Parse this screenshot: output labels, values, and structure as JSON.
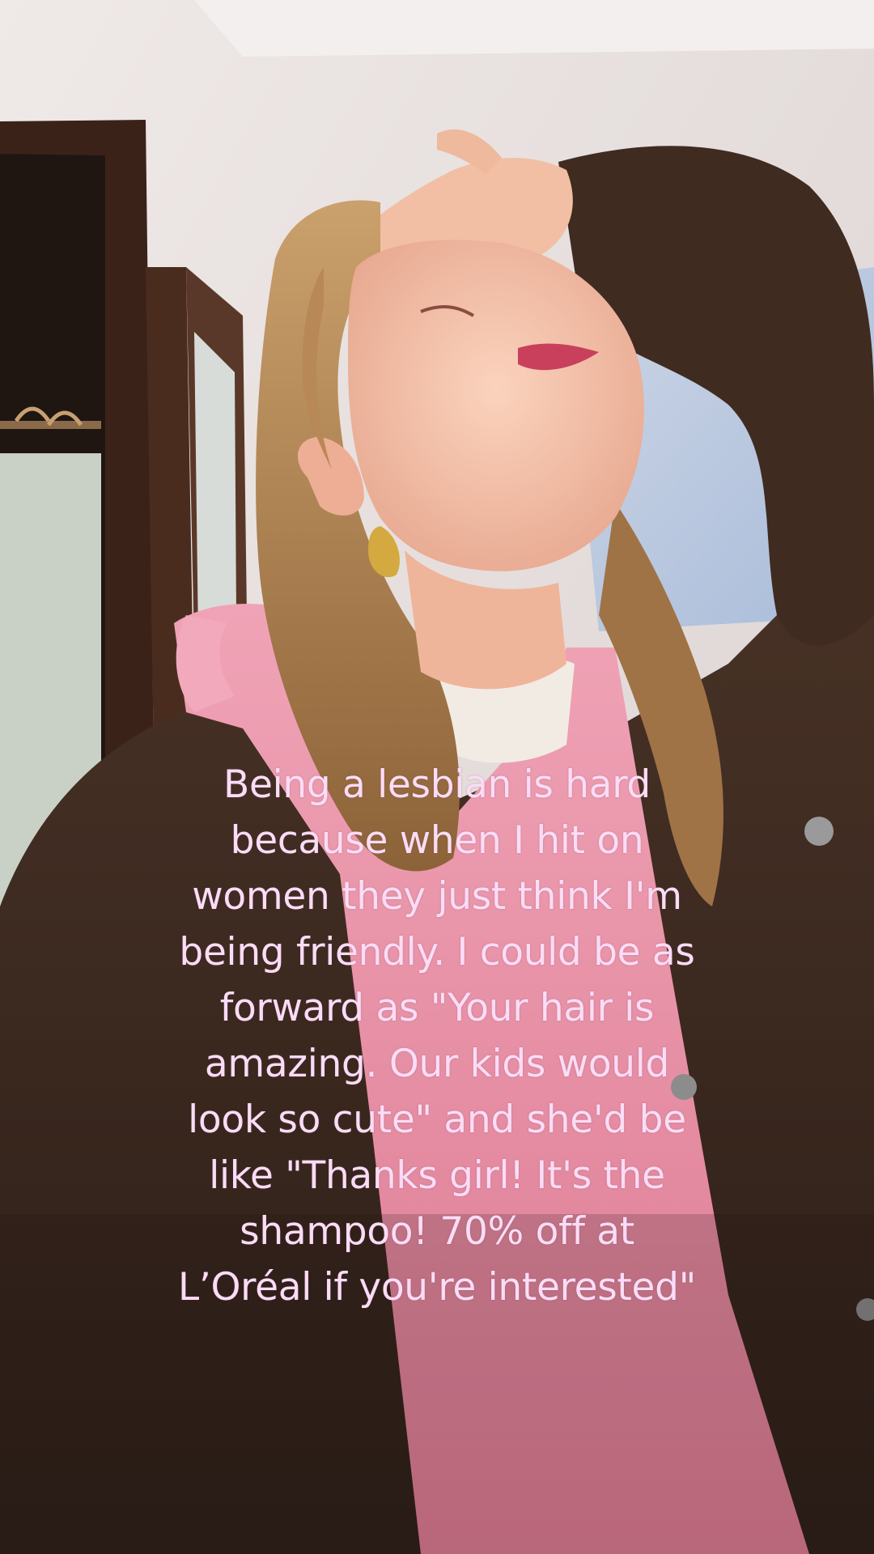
{
  "caption": {
    "lines": [
      "Being a lesbian is hard",
      "because when I hit on",
      "women they just think I'm",
      "being friendly. I could be as",
      "forward as \"Your hair is",
      "amazing. Our kids would",
      "look so cute\" and she'd be",
      "like \"Thanks girl! It's the",
      "shampoo! 70% off at",
      "L’Oréal if you're interested\""
    ],
    "color": "#fbdcf6"
  },
  "scene": {
    "description_icon": "person-looking-up-photo",
    "colors": {
      "wall": "#e6dedd",
      "window_sky": "#b9c8e0",
      "wardrobe": "#3b2219",
      "jacket": "#3d2a20",
      "hoodie": "#e58aa0",
      "hair": "#b98a57",
      "skin": "#f2c0a8"
    }
  }
}
